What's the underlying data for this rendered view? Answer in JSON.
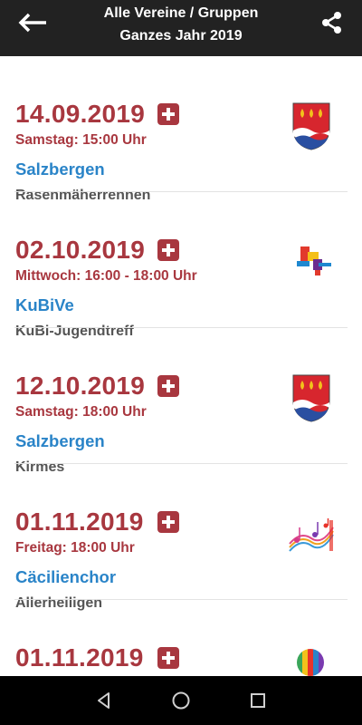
{
  "appbar": {
    "title": "Alle Vereine / Gruppen",
    "subtitle": "Ganzes Jahr 2019",
    "back_icon": "arrow-left-icon",
    "share_icon": "share-icon"
  },
  "events": [
    {
      "date": "14.09.2019",
      "time": "Samstag: 15:00 Uhr",
      "organizer": "Salzbergen",
      "title": "Rasenmäherrennen",
      "logo": "salzbergen-crest-icon"
    },
    {
      "date": "02.10.2019",
      "time": "Mittwoch: 16:00 - 18:00 Uhr",
      "organizer": "KuBiVe",
      "title": "KuBi-Jugendtreff",
      "logo": "kubive-logo-icon"
    },
    {
      "date": "12.10.2019",
      "time": "Samstag: 18:00 Uhr",
      "organizer": "Salzbergen",
      "title": "Kirmes",
      "logo": "salzbergen-crest-icon"
    },
    {
      "date": "01.11.2019",
      "time": "Freitag: 18:00 Uhr",
      "organizer": "Cäcilienchor",
      "title": "Allerheiligen",
      "logo": "music-notes-icon"
    },
    {
      "date": "01.11.2019",
      "time": "",
      "organizer": "",
      "title": "",
      "logo": "hot-air-balloon-icon"
    }
  ],
  "colors": {
    "appbar_bg": "#222222",
    "date_red": "#a8373f",
    "organizer_blue": "#2a84c8",
    "title_gray": "#555555"
  },
  "navbar": {
    "back": "nav-back-icon",
    "home": "nav-home-icon",
    "recents": "nav-recents-icon"
  }
}
